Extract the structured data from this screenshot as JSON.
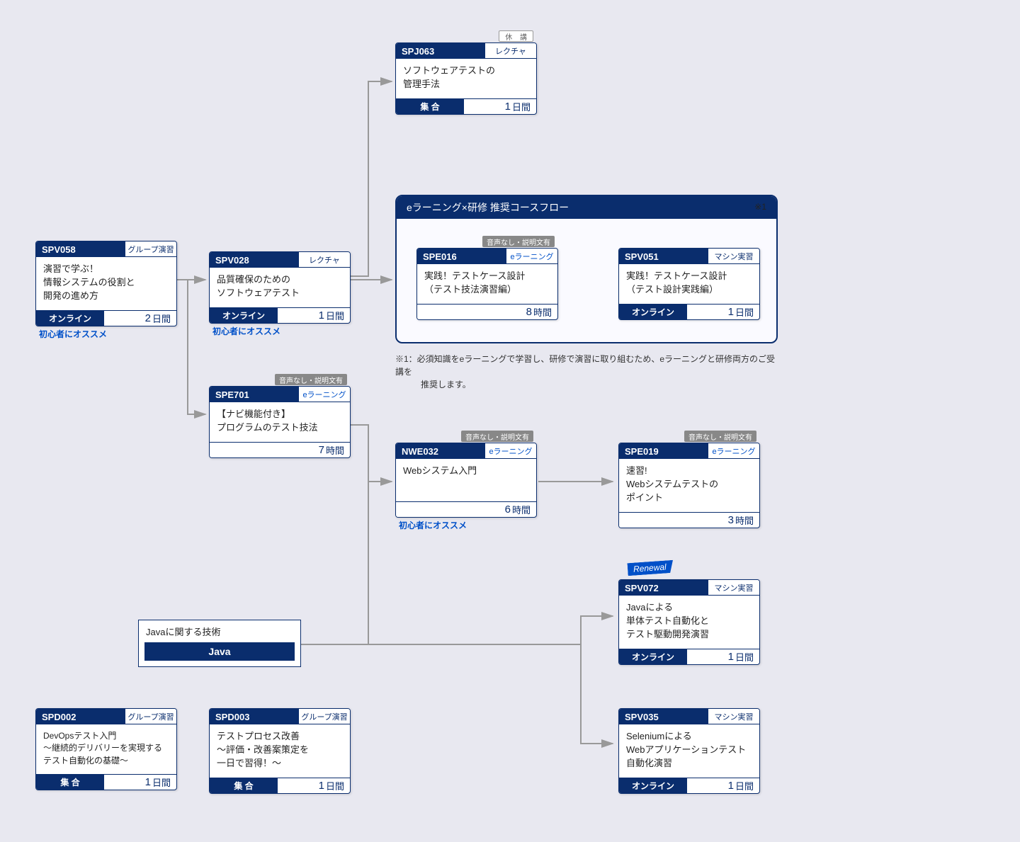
{
  "labels": {
    "recommended_beginner": "初心者にオススメ",
    "audio_badge": "音声なし・説明文有",
    "closed_badge": "休 講",
    "renewal": "Renewal"
  },
  "group": {
    "title": "eラーニング×研修 推奨コースフロー",
    "top_note": "※1"
  },
  "footnote": "※1：必須知識をeラーニングで学習し、研修で演習に取り組むため、eラーニングと研修両方のご受講を\n　　　推奨します。",
  "java_box": {
    "title": "Javaに関する技術",
    "bar": "Java"
  },
  "cards": {
    "spv058": {
      "code": "SPV058",
      "type": "グループ演習",
      "title": "演習で学ぶ！\n情報システムの役割と\n開発の進め方",
      "format": "オンライン",
      "dur_num": "2",
      "dur_unit": "日間"
    },
    "spv028": {
      "code": "SPV028",
      "type": "レクチャ",
      "title": "品質確保のための\nソフトウェアテスト",
      "format": "オンライン",
      "dur_num": "1",
      "dur_unit": "日間"
    },
    "spj063": {
      "code": "SPJ063",
      "type": "レクチャ",
      "title": "ソフトウェアテストの\n管理手法",
      "format": "集 合",
      "dur_num": "1",
      "dur_unit": "日間"
    },
    "spe701": {
      "code": "SPE701",
      "type": "eラーニング",
      "title": "【ナビ機能付き】\nプログラムのテスト技法",
      "format": "",
      "dur_num": "7",
      "dur_unit": "時間"
    },
    "spe016": {
      "code": "SPE016",
      "type": "eラーニング",
      "title": "実践！テストケース設計\n（テスト技法演習編）",
      "format": "",
      "dur_num": "8",
      "dur_unit": "時間"
    },
    "spv051": {
      "code": "SPV051",
      "type": "マシン実習",
      "title": "実践！テストケース設計\n（テスト設計実践編）",
      "format": "オンライン",
      "dur_num": "1",
      "dur_unit": "日間"
    },
    "nwe032": {
      "code": "NWE032",
      "type": "eラーニング",
      "title": "Webシステム入門",
      "format": "",
      "dur_num": "6",
      "dur_unit": "時間"
    },
    "spe019": {
      "code": "SPE019",
      "type": "eラーニング",
      "title": "速習!\nWebシステムテストの\nポイント",
      "format": "",
      "dur_num": "3",
      "dur_unit": "時間"
    },
    "spv072": {
      "code": "SPV072",
      "type": "マシン実習",
      "title": "Javaによる\n単体テスト自動化と\nテスト駆動開発演習",
      "format": "オンライン",
      "dur_num": "1",
      "dur_unit": "日間"
    },
    "spv035": {
      "code": "SPV035",
      "type": "マシン実習",
      "title": "Seleniumによる\nWebアプリケーションテスト\n自動化演習",
      "format": "オンライン",
      "dur_num": "1",
      "dur_unit": "日間"
    },
    "spd002": {
      "code": "SPD002",
      "type": "グループ演習",
      "title": "DevOpsテスト入門\n～継続的デリバリーを実現する\nテスト自動化の基礎～",
      "format": "集 合",
      "dur_num": "1",
      "dur_unit": "日間"
    },
    "spd003": {
      "code": "SPD003",
      "type": "グループ演習",
      "title": "テストプロセス改善\n～評価・改善案策定を\n一日で習得！～",
      "format": "集 合",
      "dur_num": "1",
      "dur_unit": "日間"
    }
  }
}
